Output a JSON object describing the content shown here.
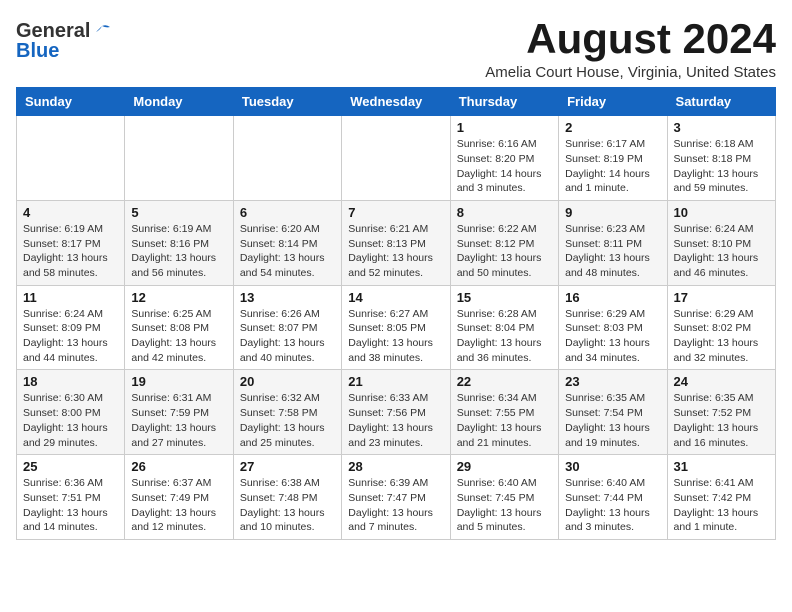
{
  "logo": {
    "line1a": "General",
    "line1b": "▲",
    "line2": "Blue"
  },
  "header": {
    "month_year": "August 2024",
    "location": "Amelia Court House, Virginia, United States"
  },
  "days_of_week": [
    "Sunday",
    "Monday",
    "Tuesday",
    "Wednesday",
    "Thursday",
    "Friday",
    "Saturday"
  ],
  "weeks": [
    [
      {
        "day": "",
        "info": ""
      },
      {
        "day": "",
        "info": ""
      },
      {
        "day": "",
        "info": ""
      },
      {
        "day": "",
        "info": ""
      },
      {
        "day": "1",
        "info": "Sunrise: 6:16 AM\nSunset: 8:20 PM\nDaylight: 14 hours\nand 3 minutes."
      },
      {
        "day": "2",
        "info": "Sunrise: 6:17 AM\nSunset: 8:19 PM\nDaylight: 14 hours\nand 1 minute."
      },
      {
        "day": "3",
        "info": "Sunrise: 6:18 AM\nSunset: 8:18 PM\nDaylight: 13 hours\nand 59 minutes."
      }
    ],
    [
      {
        "day": "4",
        "info": "Sunrise: 6:19 AM\nSunset: 8:17 PM\nDaylight: 13 hours\nand 58 minutes."
      },
      {
        "day": "5",
        "info": "Sunrise: 6:19 AM\nSunset: 8:16 PM\nDaylight: 13 hours\nand 56 minutes."
      },
      {
        "day": "6",
        "info": "Sunrise: 6:20 AM\nSunset: 8:14 PM\nDaylight: 13 hours\nand 54 minutes."
      },
      {
        "day": "7",
        "info": "Sunrise: 6:21 AM\nSunset: 8:13 PM\nDaylight: 13 hours\nand 52 minutes."
      },
      {
        "day": "8",
        "info": "Sunrise: 6:22 AM\nSunset: 8:12 PM\nDaylight: 13 hours\nand 50 minutes."
      },
      {
        "day": "9",
        "info": "Sunrise: 6:23 AM\nSunset: 8:11 PM\nDaylight: 13 hours\nand 48 minutes."
      },
      {
        "day": "10",
        "info": "Sunrise: 6:24 AM\nSunset: 8:10 PM\nDaylight: 13 hours\nand 46 minutes."
      }
    ],
    [
      {
        "day": "11",
        "info": "Sunrise: 6:24 AM\nSunset: 8:09 PM\nDaylight: 13 hours\nand 44 minutes."
      },
      {
        "day": "12",
        "info": "Sunrise: 6:25 AM\nSunset: 8:08 PM\nDaylight: 13 hours\nand 42 minutes."
      },
      {
        "day": "13",
        "info": "Sunrise: 6:26 AM\nSunset: 8:07 PM\nDaylight: 13 hours\nand 40 minutes."
      },
      {
        "day": "14",
        "info": "Sunrise: 6:27 AM\nSunset: 8:05 PM\nDaylight: 13 hours\nand 38 minutes."
      },
      {
        "day": "15",
        "info": "Sunrise: 6:28 AM\nSunset: 8:04 PM\nDaylight: 13 hours\nand 36 minutes."
      },
      {
        "day": "16",
        "info": "Sunrise: 6:29 AM\nSunset: 8:03 PM\nDaylight: 13 hours\nand 34 minutes."
      },
      {
        "day": "17",
        "info": "Sunrise: 6:29 AM\nSunset: 8:02 PM\nDaylight: 13 hours\nand 32 minutes."
      }
    ],
    [
      {
        "day": "18",
        "info": "Sunrise: 6:30 AM\nSunset: 8:00 PM\nDaylight: 13 hours\nand 29 minutes."
      },
      {
        "day": "19",
        "info": "Sunrise: 6:31 AM\nSunset: 7:59 PM\nDaylight: 13 hours\nand 27 minutes."
      },
      {
        "day": "20",
        "info": "Sunrise: 6:32 AM\nSunset: 7:58 PM\nDaylight: 13 hours\nand 25 minutes."
      },
      {
        "day": "21",
        "info": "Sunrise: 6:33 AM\nSunset: 7:56 PM\nDaylight: 13 hours\nand 23 minutes."
      },
      {
        "day": "22",
        "info": "Sunrise: 6:34 AM\nSunset: 7:55 PM\nDaylight: 13 hours\nand 21 minutes."
      },
      {
        "day": "23",
        "info": "Sunrise: 6:35 AM\nSunset: 7:54 PM\nDaylight: 13 hours\nand 19 minutes."
      },
      {
        "day": "24",
        "info": "Sunrise: 6:35 AM\nSunset: 7:52 PM\nDaylight: 13 hours\nand 16 minutes."
      }
    ],
    [
      {
        "day": "25",
        "info": "Sunrise: 6:36 AM\nSunset: 7:51 PM\nDaylight: 13 hours\nand 14 minutes."
      },
      {
        "day": "26",
        "info": "Sunrise: 6:37 AM\nSunset: 7:49 PM\nDaylight: 13 hours\nand 12 minutes."
      },
      {
        "day": "27",
        "info": "Sunrise: 6:38 AM\nSunset: 7:48 PM\nDaylight: 13 hours\nand 10 minutes."
      },
      {
        "day": "28",
        "info": "Sunrise: 6:39 AM\nSunset: 7:47 PM\nDaylight: 13 hours\nand 7 minutes."
      },
      {
        "day": "29",
        "info": "Sunrise: 6:40 AM\nSunset: 7:45 PM\nDaylight: 13 hours\nand 5 minutes."
      },
      {
        "day": "30",
        "info": "Sunrise: 6:40 AM\nSunset: 7:44 PM\nDaylight: 13 hours\nand 3 minutes."
      },
      {
        "day": "31",
        "info": "Sunrise: 6:41 AM\nSunset: 7:42 PM\nDaylight: 13 hours\nand 1 minute."
      }
    ]
  ]
}
